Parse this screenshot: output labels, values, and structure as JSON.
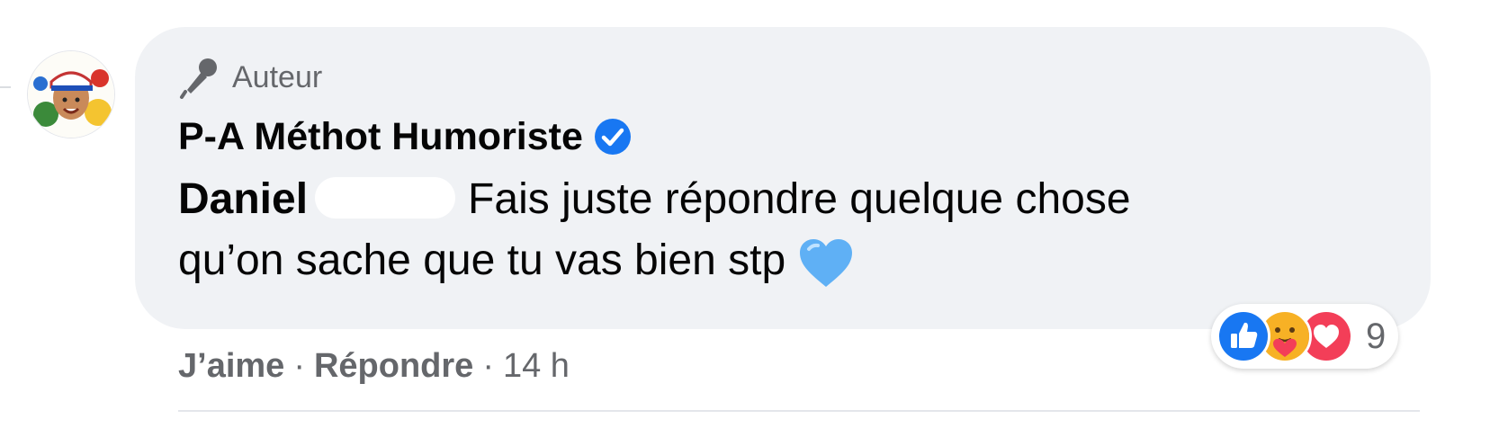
{
  "comment": {
    "badge_label": "Auteur",
    "author_name": "P-A Méthot Humoriste",
    "mention": "Daniel",
    "text_line1": "Fais juste répondre quelque chose",
    "text_line2": "qu’on sache que tu vas bien stp"
  },
  "reactions": {
    "count": "9",
    "types": [
      "like",
      "care",
      "love"
    ]
  },
  "actions": {
    "like_label": "J’aime",
    "reply_label": "Répondre",
    "separator": "·",
    "timestamp": "14 h"
  },
  "colors": {
    "bubble_bg": "#f0f2f5",
    "secondary_text": "#65676b",
    "verified_blue": "#1877f2",
    "like_blue": "#1877f2",
    "love_red": "#f33e58",
    "care_yellow": "#f7b125",
    "heart_emoji": "#5fb0f5"
  },
  "icons": {
    "badge": "microphone-icon",
    "verified": "verified-check-icon",
    "emoji": "blue-heart-emoji"
  }
}
